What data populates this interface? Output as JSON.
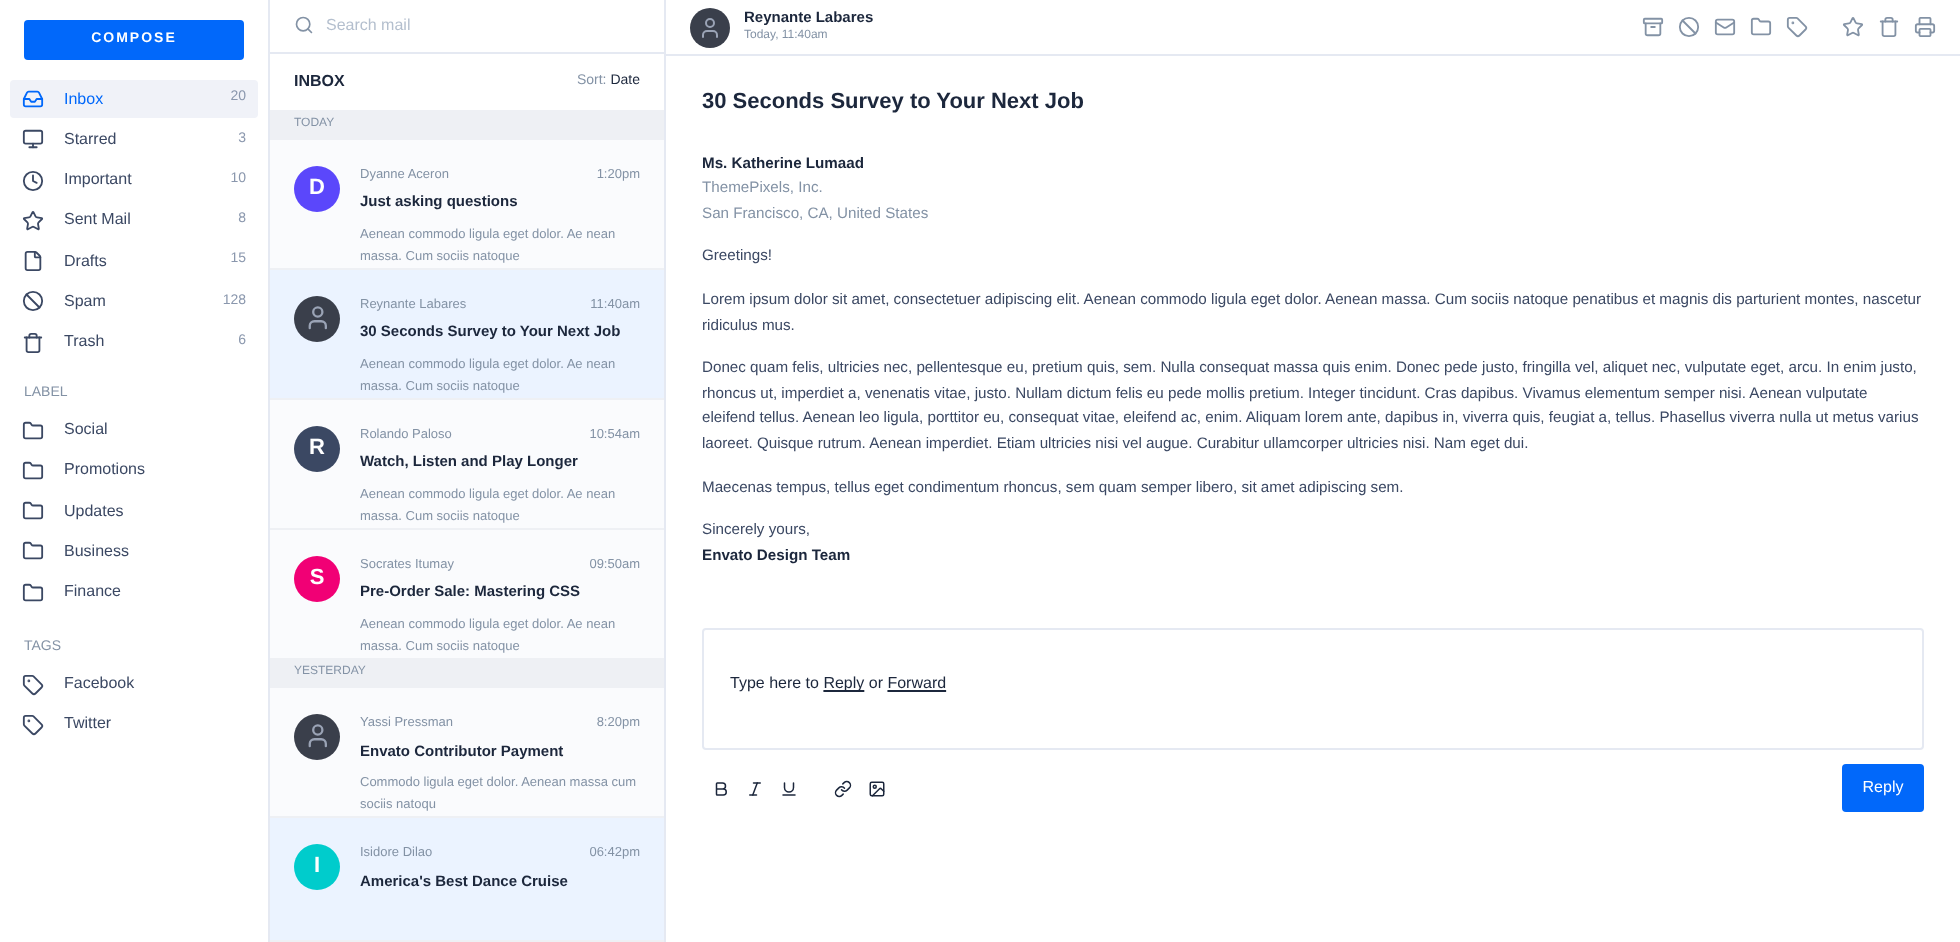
{
  "sidebar": {
    "compose": "COMPOSE",
    "folders": [
      {
        "label": "Inbox",
        "count": "20",
        "selected": true
      },
      {
        "label": "Starred",
        "count": "3",
        "selected": false
      },
      {
        "label": "Important",
        "count": "10",
        "selected": false
      },
      {
        "label": "Sent Mail",
        "count": "8",
        "selected": false
      },
      {
        "label": "Drafts",
        "count": "15",
        "selected": false
      },
      {
        "label": "Spam",
        "count": "128",
        "selected": false
      },
      {
        "label": "Trash",
        "count": "6",
        "selected": false
      }
    ],
    "label_heading": "LABEL",
    "labels": [
      "Social",
      "Promotions",
      "Updates",
      "Business",
      "Finance"
    ],
    "tags_heading": "TAGS",
    "tags": [
      "Facebook",
      "Twitter"
    ]
  },
  "mail_list": {
    "search_placeholder": "Search mail",
    "title": "INBOX",
    "sort_label": "Sort:",
    "sort_value": "Date",
    "groups": [
      {
        "heading": "TODAY",
        "items": [
          {
            "avatar": {
              "kind": "letter",
              "letter": "D",
              "color": "#5b47fb"
            },
            "sender": "Dyanne Aceron",
            "time": "1:20pm",
            "subject": "Just asking questions",
            "preview": "Aenean commodo ligula eget dolor. Ae nean massa. Cum sociis natoque",
            "selected": false
          },
          {
            "avatar": {
              "kind": "photo"
            },
            "sender": "Reynante Labares",
            "time": "11:40am",
            "subject": "30 Seconds Survey to Your Next Job",
            "preview": "Aenean commodo ligula eget dolor. Ae nean massa. Cum sociis natoque",
            "selected": true
          },
          {
            "avatar": {
              "kind": "letter",
              "letter": "R",
              "color": "#3b4863"
            },
            "sender": "Rolando Paloso",
            "time": "10:54am",
            "subject": "Watch, Listen and Play Longer",
            "preview": "Aenean commodo ligula eget dolor. Ae nean massa. Cum sociis natoque",
            "selected": false
          },
          {
            "avatar": {
              "kind": "letter",
              "letter": "S",
              "color": "#f10075"
            },
            "sender": "Socrates Itumay",
            "time": "09:50am",
            "subject": "Pre-Order Sale: Mastering CSS",
            "preview": "Aenean commodo ligula eget dolor. Ae nean massa. Cum sociis natoque",
            "selected": false
          }
        ]
      },
      {
        "heading": "YESTERDAY",
        "items": [
          {
            "avatar": {
              "kind": "photo"
            },
            "sender": "Yassi Pressman",
            "time": "8:20pm",
            "subject": "Envato Contributor Payment",
            "preview": "Commodo ligula eget dolor. Aenean massa cum sociis natoqu",
            "selected": false
          },
          {
            "avatar": {
              "kind": "letter",
              "letter": "I",
              "color": "#00cccc"
            },
            "sender": "Isidore Dilao",
            "time": "06:42pm",
            "subject": "America's Best Dance Cruise",
            "selected": true
          }
        ]
      }
    ]
  },
  "message": {
    "sender": "Reynante Labares",
    "date": "Today, 11:40am",
    "subject": "30 Seconds Survey to Your Next Job",
    "recipient": {
      "name": "Ms. Katherine Lumaad",
      "company": "ThemePixels, Inc.",
      "location": "San Francisco, CA, United States"
    },
    "greeting": "Greetings!",
    "paragraphs": [
      "Lorem ipsum dolor sit amet, consectetuer adipiscing elit. Aenean commodo ligula eget dolor. Aenean massa. Cum sociis natoque penatibus et magnis dis parturient montes, nascetur ridiculus mus.",
      "Donec quam felis, ultricies nec, pellentesque eu, pretium quis, sem. Nulla consequat massa quis enim. Donec pede justo, fringilla vel, aliquet nec, vulputate eget, arcu. In enim justo, rhoncus ut, imperdiet a, venenatis vitae, justo. Nullam dictum felis eu pede mollis pretium. Integer tincidunt. Cras dapibus. Vivamus elementum semper nisi. Aenean vulputate eleifend tellus. Aenean leo ligula, porttitor eu, consequat vitae, eleifend ac, enim. Aliquam lorem ante, dapibus in, viverra quis, feugiat a, tellus. Phasellus viverra nulla ut metus varius laoreet. Quisque rutrum. Aenean imperdiet. Etiam ultricies nisi vel augue. Curabitur ullamcorper ultricies nisi. Nam eget dui.",
      "Maecenas tempus, tellus eget condimentum rhoncus, sem quam semper libero, sit amet adipiscing sem."
    ],
    "closing": "Sincerely yours,",
    "signature": "Envato Design Team"
  },
  "reply_box": {
    "parts": [
      {
        "kind": "text",
        "text": "Type here to "
      },
      {
        "kind": "link",
        "text": "Reply"
      },
      {
        "kind": "text",
        "text": " or "
      },
      {
        "kind": "link",
        "text": "Forward"
      }
    ],
    "button": "Reply"
  }
}
